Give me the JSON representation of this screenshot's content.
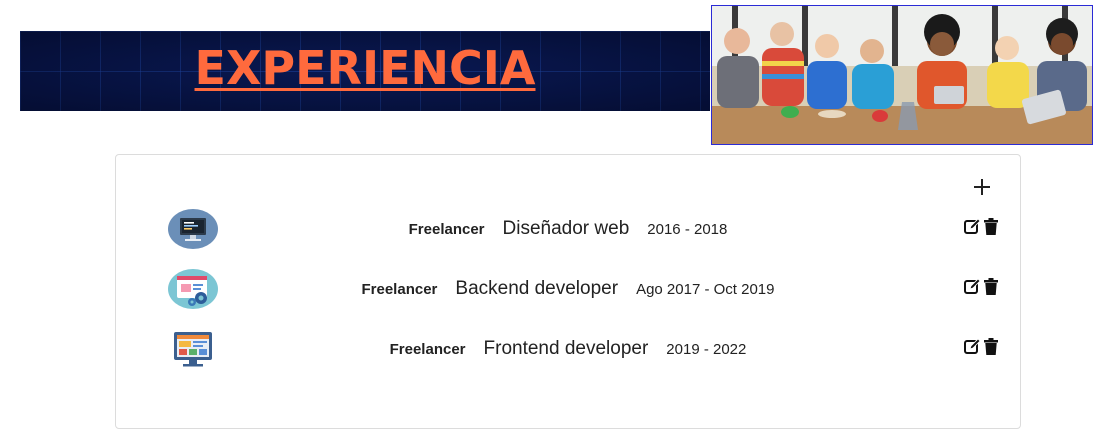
{
  "banner": {
    "title": "EXPERIENCIA"
  },
  "colors": {
    "accent": "#ff6a3d",
    "banner_bg": "#07154a"
  },
  "experience": {
    "items": [
      {
        "company": "Freelancer",
        "role": "Diseñador web",
        "period": "2016 - 2018",
        "icon": "monitor-code-icon"
      },
      {
        "company": "Freelancer",
        "role": "Backend developer",
        "period": "Ago 2017 - Oct 2019",
        "icon": "screen-gears-icon"
      },
      {
        "company": "Freelancer",
        "role": "Frontend developer",
        "period": "2019 - 2022",
        "icon": "web-layout-icon"
      }
    ]
  }
}
